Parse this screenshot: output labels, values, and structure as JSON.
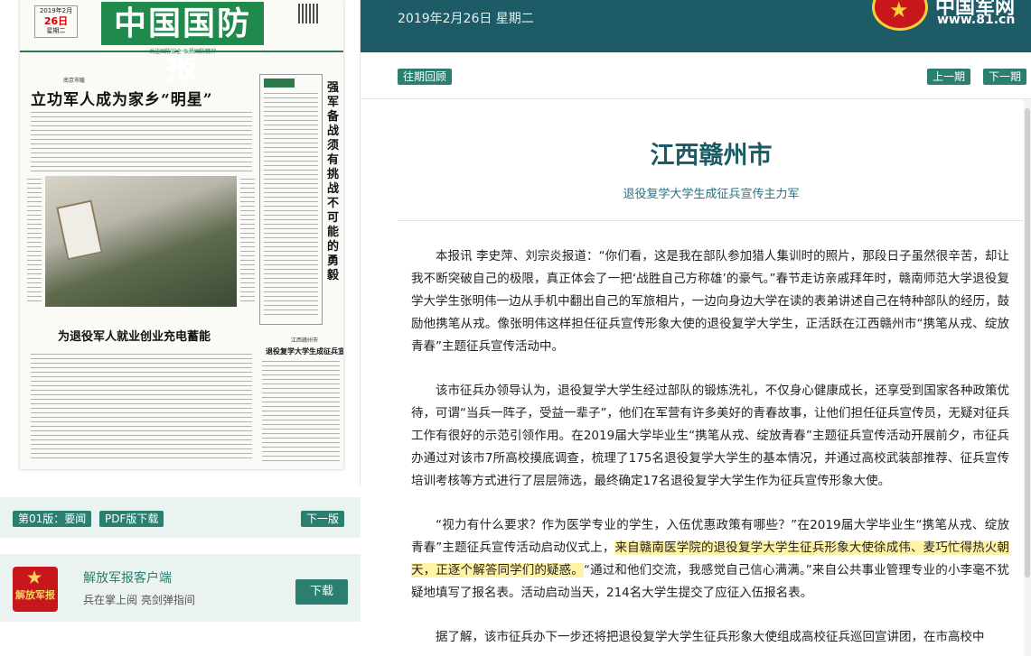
{
  "newspaper": {
    "name": "中国国防报",
    "date_day": "26日",
    "date_line": "2019年2月",
    "weekday": "星期二",
    "tagline": "关注国防安全 弘扬国防精神",
    "kicker1": "南京市暖",
    "headline1": "立功军人成为家乡“明星”",
    "headline2": "为退役军人就业创业充电蓄能",
    "vertical_headline": "强军备战须有挑战不可能的勇毅",
    "kicker3": "江西赣州市",
    "headline3": "退役复学大学生成征兵宣传主力军"
  },
  "edition": {
    "page_label": "第01版：要闻",
    "pdf_label": "PDF版下载",
    "next_edition": "下一版"
  },
  "client": {
    "logo_text": "解放军报",
    "name": "解放军报客户端",
    "desc": "兵在掌上阅 亮剑弹指间",
    "download": "下载"
  },
  "header": {
    "date": "2019年2月26日 星期二",
    "site_name": "中国军网",
    "site_url": "www.81.cn"
  },
  "nav": {
    "archive": "往期回顾",
    "prev": "上一期",
    "next": "下一期"
  },
  "article": {
    "title": "江西赣州市",
    "subtitle": "退役复学大学生成征兵宣传主力军",
    "p1": "本报讯 李史萍、刘宗炎报道：“你们看，这是我在部队参加猎人集训时的照片，那段日子虽然很辛苦，却让我不断突破自己的极限，真正体会了一把‘战胜自己方称雄’的豪气。”春节走访亲戚拜年时，赣南师范大学退役复学大学生张明伟一边从手机中翻出自己的军旅相片，一边向身边大学在读的表弟讲述自己在特种部队的经历，鼓励他携笔从戎。像张明伟这样担任征兵宣传形象大使的退役复学大学生，正活跃在江西赣州市“携笔从戎、绽放青春”主题征兵宣传活动中。",
    "p2": "该市征兵办领导认为，退役复学大学生经过部队的锻炼洗礼，不仅身心健康成长，还享受到国家各种政策优待，可谓“当兵一阵子，受益一辈子”，他们在军营有许多美好的青春故事，让他们担任征兵宣传员，无疑对征兵工作有很好的示范引领作用。在2019届大学毕业生“携笔从戎、绽放青春”主题征兵宣传活动开展前夕，市征兵办通过对该市7所高校摸底调查，梳理了175名退役复学大学生的基本情况，并通过高校武装部推荐、征兵宣传培训考核等方式进行了层层筛选，最终确定17名退役复学大学生作为征兵宣传形象大使。",
    "p3_before": "“视力有什么要求？作为医学专业的学生，入伍优惠政策有哪些？”在2019届大学毕业生“携笔从戎、绽放青春”主题征兵宣传活动启动仪式上，",
    "p3_highlight": "来自赣南医学院的退役复学大学生征兵形象大使徐成伟、麦巧忙得热火朝天，正逐个解答同学们的疑惑。",
    "p3_after": "“通过和他们交流，我感觉自己信心满满。”来自公共事业管理专业的小李毫不犹疑地填写了报名表。活动启动当天，214名大学生提交了应征入伍报名表。",
    "p4": "据了解，该市征兵办下一步还将把退役复学大学生征兵形象大使组成高校征兵巡回宣讲团，在市高校中"
  },
  "colors": {
    "header_bg": "#1d5b66",
    "button_bg": "#2b7f70",
    "title_color": "#1c5a64",
    "highlight": "#fff3a6"
  }
}
